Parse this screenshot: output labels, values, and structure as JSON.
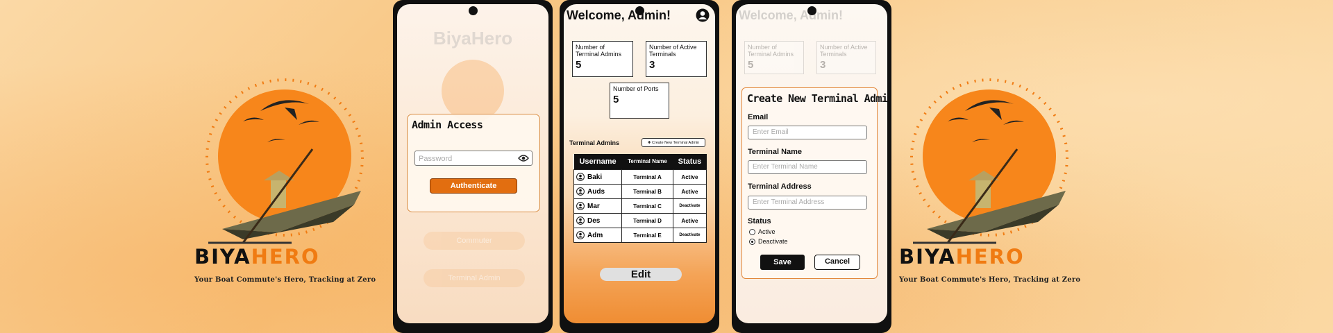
{
  "brand": {
    "name_part1": "BIYA",
    "name_part2": "HERO",
    "tagline": "Your Boat Commute's Hero, Tracking at Zero"
  },
  "colors": {
    "accent": "#f07b12",
    "button_dark": "#111111",
    "sun": "#f7861b"
  },
  "login": {
    "app_title": "BiyaHero",
    "modal_title": "Admin Access",
    "password_placeholder": "Password",
    "eye_icon": "eye-icon",
    "authenticate_label": "Authenticate",
    "commuter_label": "Commuter",
    "terminal_admin_label": "Terminal Admin"
  },
  "dashboard": {
    "welcome": "Welcome, Admin!",
    "stats": [
      {
        "label": "Number of Terminal Admins",
        "value": "5"
      },
      {
        "label": "Number of Active Terminals",
        "value": "3"
      },
      {
        "label": "Number of Ports",
        "value": "5"
      }
    ],
    "section_title": "Terminal Admins",
    "create_button": "Create New Terminal Admin",
    "columns": [
      "Username",
      "Terminal Name",
      "Status"
    ],
    "rows": [
      {
        "username": "Baki",
        "terminal": "Terminal A",
        "status": "Active"
      },
      {
        "username": "Auds",
        "terminal": "Terminal B",
        "status": "Active"
      },
      {
        "username": "Mar",
        "terminal": "Terminal C",
        "status": "Deactivate"
      },
      {
        "username": "Des",
        "terminal": "Terminal D",
        "status": "Active"
      },
      {
        "username": "Adm",
        "terminal": "Terminal E",
        "status": "Deactivate"
      }
    ],
    "edit_label": "Edit"
  },
  "create_form": {
    "title": "Create New Terminal Admin",
    "email_label": "Email",
    "email_placeholder": "Enter Email",
    "terminal_name_label": "Terminal Name",
    "terminal_name_placeholder": "Enter Terminal Name",
    "terminal_address_label": "Terminal Address",
    "terminal_address_placeholder": "Enter Terminal Address",
    "status_label": "Status",
    "status_options": [
      "Active",
      "Deactivate"
    ],
    "status_selected": "Deactivate",
    "save_label": "Save",
    "cancel_label": "Cancel"
  }
}
